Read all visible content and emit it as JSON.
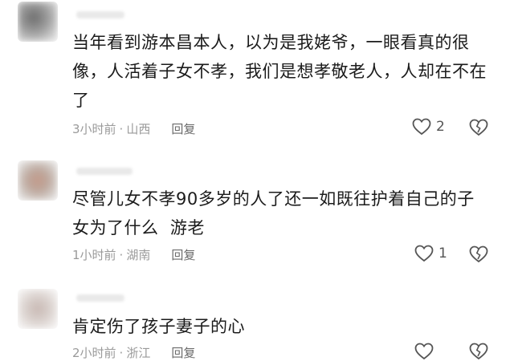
{
  "comments": [
    {
      "text": "当年看到游本昌本人，以为是我姥爷，一眼看真的很像，人活着子女不孝，我们是想孝敬老人，人却在不在了",
      "time": "3小时前",
      "location": "山西",
      "reply_label": "回复",
      "likes": "2"
    },
    {
      "text": "尽管儿女不孝90多岁的人了还一如既往护着自己的子女为了什么  游老",
      "time": "1小时前",
      "location": "湖南",
      "reply_label": "回复",
      "likes": "1"
    },
    {
      "text": "肯定伤了孩子妻子的心",
      "time": "2小时前",
      "location": "浙江",
      "reply_label": "回复",
      "likes": ""
    }
  ],
  "meta_separator": "·",
  "icons": {
    "like": "heart-outline-icon",
    "dislike": "broken-heart-icon"
  }
}
